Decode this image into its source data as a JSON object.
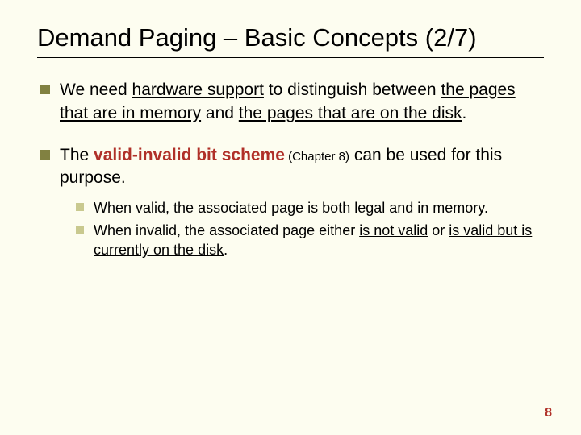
{
  "title": "Demand Paging – Basic Concepts (2/7)",
  "bullets": [
    {
      "pre": "We need ",
      "u1": "hardware support",
      "mid1": " to distinguish between ",
      "u2": "the pages that are in memory",
      "mid2": " and ",
      "u3": "the pages that are on the disk",
      "post": "."
    },
    {
      "pre": "The ",
      "bold": "valid-invalid bit scheme",
      "chap": " (Chapter 8)",
      "post": " can be used for this purpose."
    }
  ],
  "subbullets": [
    {
      "text": "When valid, the associated page is both legal and in memory."
    },
    {
      "pre": "When invalid, the associated page either ",
      "u1": "is not valid",
      "mid": " or ",
      "u2": "is valid but is currently on the disk",
      "post": "."
    }
  ],
  "page_number": "8"
}
